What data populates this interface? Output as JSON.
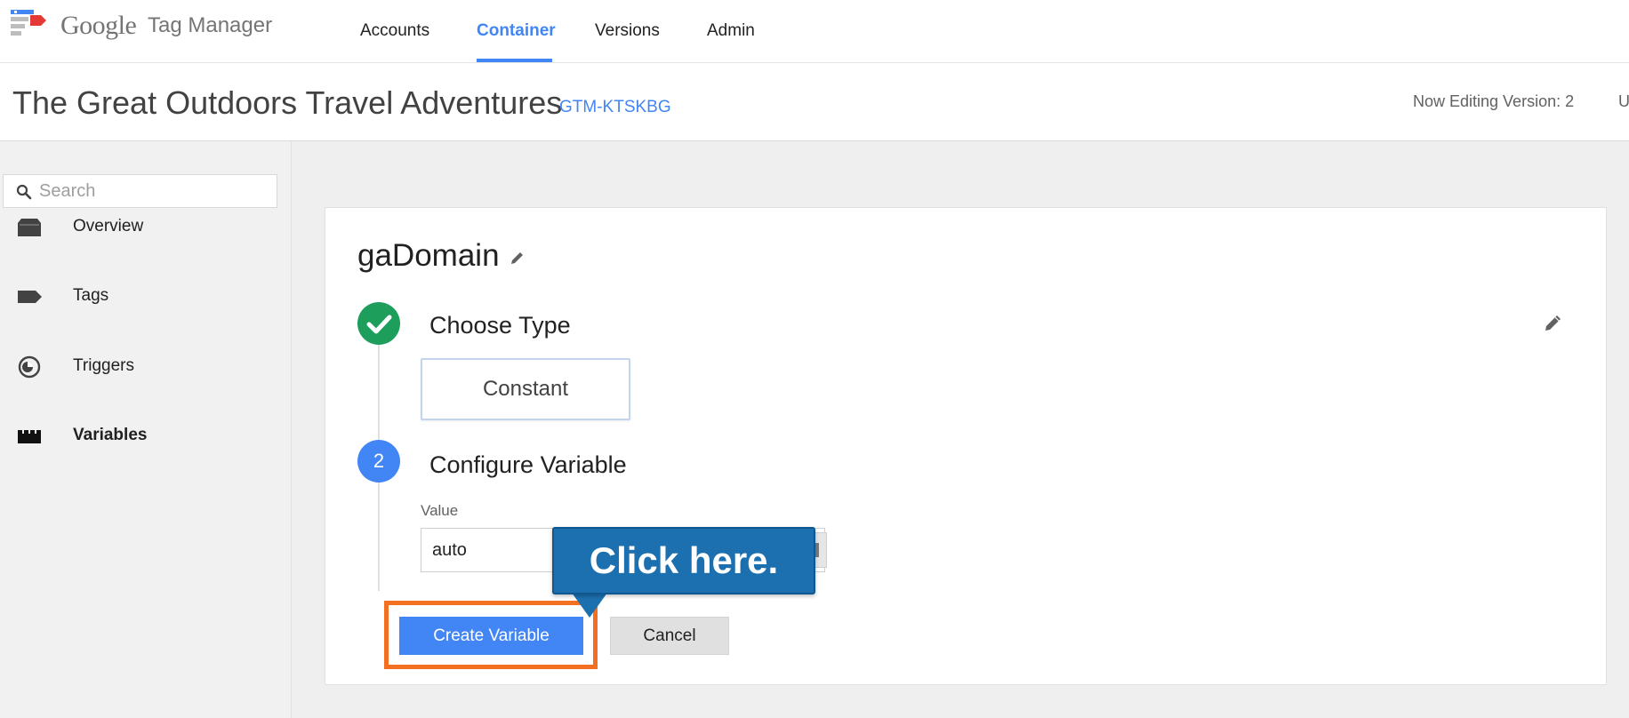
{
  "app": {
    "brand": "Google",
    "product": "Tag Manager"
  },
  "nav": {
    "items": [
      {
        "label": "Accounts"
      },
      {
        "label": "Container",
        "active": true
      },
      {
        "label": "Versions"
      },
      {
        "label": "Admin"
      }
    ]
  },
  "container": {
    "name": "The Great Outdoors Travel Adventures",
    "id": "GTM-KTSKBG",
    "editing_status": "Now Editing Version: 2",
    "edge_text": "U"
  },
  "sidebar": {
    "search_placeholder": "Search",
    "items": [
      {
        "label": "Overview",
        "icon": "folder-icon"
      },
      {
        "label": "Tags",
        "icon": "tag-icon"
      },
      {
        "label": "Triggers",
        "icon": "trigger-icon"
      },
      {
        "label": "Variables",
        "icon": "variables-icon",
        "active": true
      }
    ]
  },
  "variable": {
    "name": "gaDomain",
    "step1": {
      "title": "Choose Type",
      "type": "Constant",
      "status": "complete"
    },
    "step2": {
      "number": "2",
      "title": "Configure Variable",
      "value_label": "Value",
      "value": "auto"
    },
    "create_label": "Create Variable",
    "cancel_label": "Cancel"
  },
  "annotation": {
    "callout_text": "Click here.",
    "highlight_color": "#f36f21",
    "callout_color": "#1d70b0"
  },
  "colors": {
    "accent": "#4285f4",
    "success": "#1e9e5b"
  }
}
